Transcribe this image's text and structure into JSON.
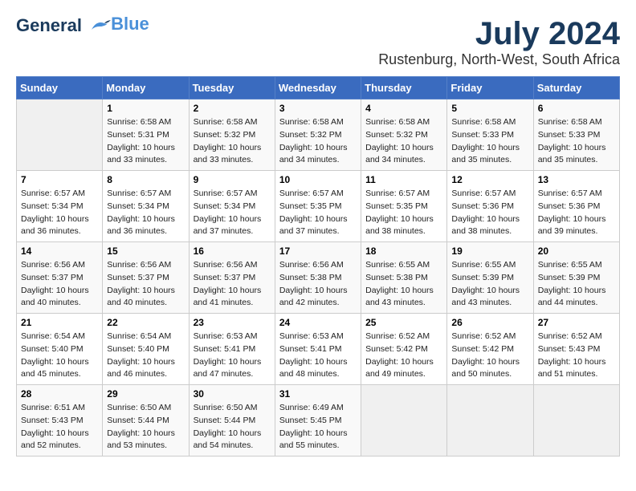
{
  "header": {
    "logo_line1": "General",
    "logo_line2": "Blue",
    "month_year": "July 2024",
    "location": "Rustenburg, North-West, South Africa"
  },
  "weekdays": [
    "Sunday",
    "Monday",
    "Tuesday",
    "Wednesday",
    "Thursday",
    "Friday",
    "Saturday"
  ],
  "weeks": [
    [
      {
        "day": "",
        "sunrise": "",
        "sunset": "",
        "daylight": ""
      },
      {
        "day": "1",
        "sunrise": "Sunrise: 6:58 AM",
        "sunset": "Sunset: 5:31 PM",
        "daylight": "Daylight: 10 hours and 33 minutes."
      },
      {
        "day": "2",
        "sunrise": "Sunrise: 6:58 AM",
        "sunset": "Sunset: 5:32 PM",
        "daylight": "Daylight: 10 hours and 33 minutes."
      },
      {
        "day": "3",
        "sunrise": "Sunrise: 6:58 AM",
        "sunset": "Sunset: 5:32 PM",
        "daylight": "Daylight: 10 hours and 34 minutes."
      },
      {
        "day": "4",
        "sunrise": "Sunrise: 6:58 AM",
        "sunset": "Sunset: 5:32 PM",
        "daylight": "Daylight: 10 hours and 34 minutes."
      },
      {
        "day": "5",
        "sunrise": "Sunrise: 6:58 AM",
        "sunset": "Sunset: 5:33 PM",
        "daylight": "Daylight: 10 hours and 35 minutes."
      },
      {
        "day": "6",
        "sunrise": "Sunrise: 6:58 AM",
        "sunset": "Sunset: 5:33 PM",
        "daylight": "Daylight: 10 hours and 35 minutes."
      }
    ],
    [
      {
        "day": "7",
        "sunrise": "Sunrise: 6:57 AM",
        "sunset": "Sunset: 5:34 PM",
        "daylight": "Daylight: 10 hours and 36 minutes."
      },
      {
        "day": "8",
        "sunrise": "Sunrise: 6:57 AM",
        "sunset": "Sunset: 5:34 PM",
        "daylight": "Daylight: 10 hours and 36 minutes."
      },
      {
        "day": "9",
        "sunrise": "Sunrise: 6:57 AM",
        "sunset": "Sunset: 5:34 PM",
        "daylight": "Daylight: 10 hours and 37 minutes."
      },
      {
        "day": "10",
        "sunrise": "Sunrise: 6:57 AM",
        "sunset": "Sunset: 5:35 PM",
        "daylight": "Daylight: 10 hours and 37 minutes."
      },
      {
        "day": "11",
        "sunrise": "Sunrise: 6:57 AM",
        "sunset": "Sunset: 5:35 PM",
        "daylight": "Daylight: 10 hours and 38 minutes."
      },
      {
        "day": "12",
        "sunrise": "Sunrise: 6:57 AM",
        "sunset": "Sunset: 5:36 PM",
        "daylight": "Daylight: 10 hours and 38 minutes."
      },
      {
        "day": "13",
        "sunrise": "Sunrise: 6:57 AM",
        "sunset": "Sunset: 5:36 PM",
        "daylight": "Daylight: 10 hours and 39 minutes."
      }
    ],
    [
      {
        "day": "14",
        "sunrise": "Sunrise: 6:56 AM",
        "sunset": "Sunset: 5:37 PM",
        "daylight": "Daylight: 10 hours and 40 minutes."
      },
      {
        "day": "15",
        "sunrise": "Sunrise: 6:56 AM",
        "sunset": "Sunset: 5:37 PM",
        "daylight": "Daylight: 10 hours and 40 minutes."
      },
      {
        "day": "16",
        "sunrise": "Sunrise: 6:56 AM",
        "sunset": "Sunset: 5:37 PM",
        "daylight": "Daylight: 10 hours and 41 minutes."
      },
      {
        "day": "17",
        "sunrise": "Sunrise: 6:56 AM",
        "sunset": "Sunset: 5:38 PM",
        "daylight": "Daylight: 10 hours and 42 minutes."
      },
      {
        "day": "18",
        "sunrise": "Sunrise: 6:55 AM",
        "sunset": "Sunset: 5:38 PM",
        "daylight": "Daylight: 10 hours and 43 minutes."
      },
      {
        "day": "19",
        "sunrise": "Sunrise: 6:55 AM",
        "sunset": "Sunset: 5:39 PM",
        "daylight": "Daylight: 10 hours and 43 minutes."
      },
      {
        "day": "20",
        "sunrise": "Sunrise: 6:55 AM",
        "sunset": "Sunset: 5:39 PM",
        "daylight": "Daylight: 10 hours and 44 minutes."
      }
    ],
    [
      {
        "day": "21",
        "sunrise": "Sunrise: 6:54 AM",
        "sunset": "Sunset: 5:40 PM",
        "daylight": "Daylight: 10 hours and 45 minutes."
      },
      {
        "day": "22",
        "sunrise": "Sunrise: 6:54 AM",
        "sunset": "Sunset: 5:40 PM",
        "daylight": "Daylight: 10 hours and 46 minutes."
      },
      {
        "day": "23",
        "sunrise": "Sunrise: 6:53 AM",
        "sunset": "Sunset: 5:41 PM",
        "daylight": "Daylight: 10 hours and 47 minutes."
      },
      {
        "day": "24",
        "sunrise": "Sunrise: 6:53 AM",
        "sunset": "Sunset: 5:41 PM",
        "daylight": "Daylight: 10 hours and 48 minutes."
      },
      {
        "day": "25",
        "sunrise": "Sunrise: 6:52 AM",
        "sunset": "Sunset: 5:42 PM",
        "daylight": "Daylight: 10 hours and 49 minutes."
      },
      {
        "day": "26",
        "sunrise": "Sunrise: 6:52 AM",
        "sunset": "Sunset: 5:42 PM",
        "daylight": "Daylight: 10 hours and 50 minutes."
      },
      {
        "day": "27",
        "sunrise": "Sunrise: 6:52 AM",
        "sunset": "Sunset: 5:43 PM",
        "daylight": "Daylight: 10 hours and 51 minutes."
      }
    ],
    [
      {
        "day": "28",
        "sunrise": "Sunrise: 6:51 AM",
        "sunset": "Sunset: 5:43 PM",
        "daylight": "Daylight: 10 hours and 52 minutes."
      },
      {
        "day": "29",
        "sunrise": "Sunrise: 6:50 AM",
        "sunset": "Sunset: 5:44 PM",
        "daylight": "Daylight: 10 hours and 53 minutes."
      },
      {
        "day": "30",
        "sunrise": "Sunrise: 6:50 AM",
        "sunset": "Sunset: 5:44 PM",
        "daylight": "Daylight: 10 hours and 54 minutes."
      },
      {
        "day": "31",
        "sunrise": "Sunrise: 6:49 AM",
        "sunset": "Sunset: 5:45 PM",
        "daylight": "Daylight: 10 hours and 55 minutes."
      },
      {
        "day": "",
        "sunrise": "",
        "sunset": "",
        "daylight": ""
      },
      {
        "day": "",
        "sunrise": "",
        "sunset": "",
        "daylight": ""
      },
      {
        "day": "",
        "sunrise": "",
        "sunset": "",
        "daylight": ""
      }
    ]
  ]
}
